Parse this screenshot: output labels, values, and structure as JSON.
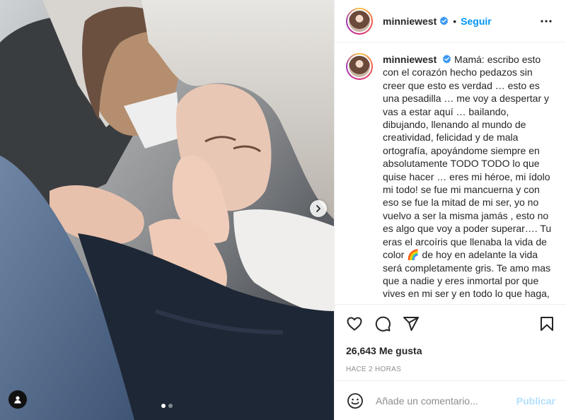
{
  "post": {
    "username": "minniewest",
    "follow_label": "Seguir",
    "separator": "•",
    "caption": "Mamá: escribo esto con el corazón hecho pedazos sin creer que esto es verdad … esto es una pesadilla … me voy a despertar y vas a estar aquí … bailando, dibujando, llenando al mundo de creatividad, felicidad y de mala ortografía, apoyándome siempre en absolutamente TODO TODO lo que quise hacer … eres mi héroe, mi ídolo mi todo! se fue mi mancuerna y con eso se fue la mitad de mi ser, yo no vuelvo a ser la misma jamás , esto no es algo que voy a poder superar…. Tu eras el arcoíris que llenaba la vida de color 🌈 de hoy en adelante la vida será completamente gris. Te amo mas que a nadie y eres inmortal por que vives en mi ser y en todo lo que haga, lo cual te dedicaré todo siempre a ti!",
    "likes_count": "26,643",
    "likes_label": "Me gusta",
    "time_ago": "HACE 2 HORAS"
  },
  "comment": {
    "placeholder": "Añade un comentario...",
    "publish_label": "Publicar"
  },
  "carousel": {
    "slides": 2,
    "active_index": 0
  },
  "icons": {
    "verified": "verified-badge-icon",
    "more": "more-options-icon",
    "like": "heart-icon",
    "comment": "comment-icon",
    "share": "share-icon",
    "save": "bookmark-icon",
    "emoji": "emoji-icon",
    "next": "chevron-right-icon",
    "tag": "user-tag-icon"
  },
  "colors": {
    "accent": "#0095f6",
    "publish_disabled": "#b2dffc",
    "verified": "#3897f0",
    "secondary_text": "#8e8e8e"
  }
}
